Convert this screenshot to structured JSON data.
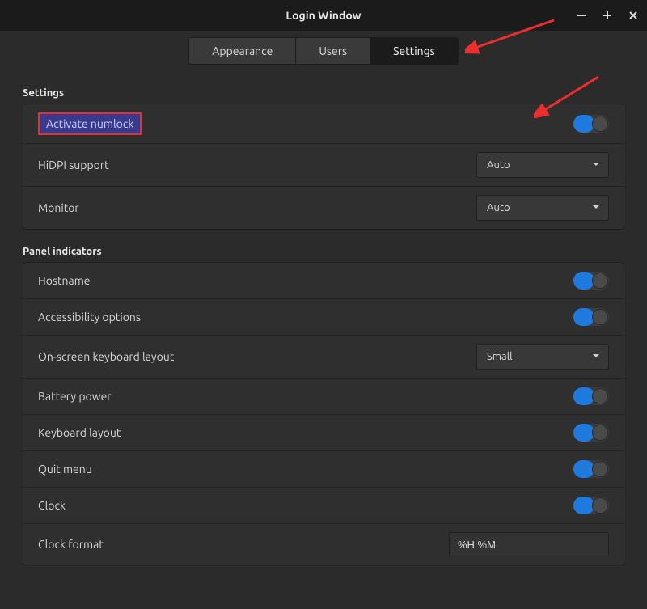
{
  "window": {
    "title": "Login Window"
  },
  "tabs": {
    "appearance": "Appearance",
    "users": "Users",
    "settings": "Settings",
    "active": "settings"
  },
  "sections": {
    "settings": {
      "title": "Settings",
      "rows": {
        "numlock": {
          "label": "Activate numlock",
          "toggle": true
        },
        "hidpi": {
          "label": "HiDPI support",
          "dropdown": "Auto"
        },
        "monitor": {
          "label": "Monitor",
          "dropdown": "Auto"
        }
      }
    },
    "panel": {
      "title": "Panel indicators",
      "rows": {
        "hostname": {
          "label": "Hostname",
          "toggle": true
        },
        "accessibility": {
          "label": "Accessibility options",
          "toggle": true
        },
        "osk": {
          "label": "On-screen keyboard layout",
          "dropdown": "Small"
        },
        "battery": {
          "label": "Battery power",
          "toggle": true
        },
        "kblayout": {
          "label": "Keyboard layout",
          "toggle": true
        },
        "quit": {
          "label": "Quit menu",
          "toggle": true
        },
        "clock": {
          "label": "Clock",
          "toggle": true
        },
        "clockfmt": {
          "label": "Clock format",
          "text": "%H:%M"
        }
      }
    }
  },
  "colors": {
    "accent": "#1f7ae0",
    "highlight_border": "#ec2e2e"
  }
}
